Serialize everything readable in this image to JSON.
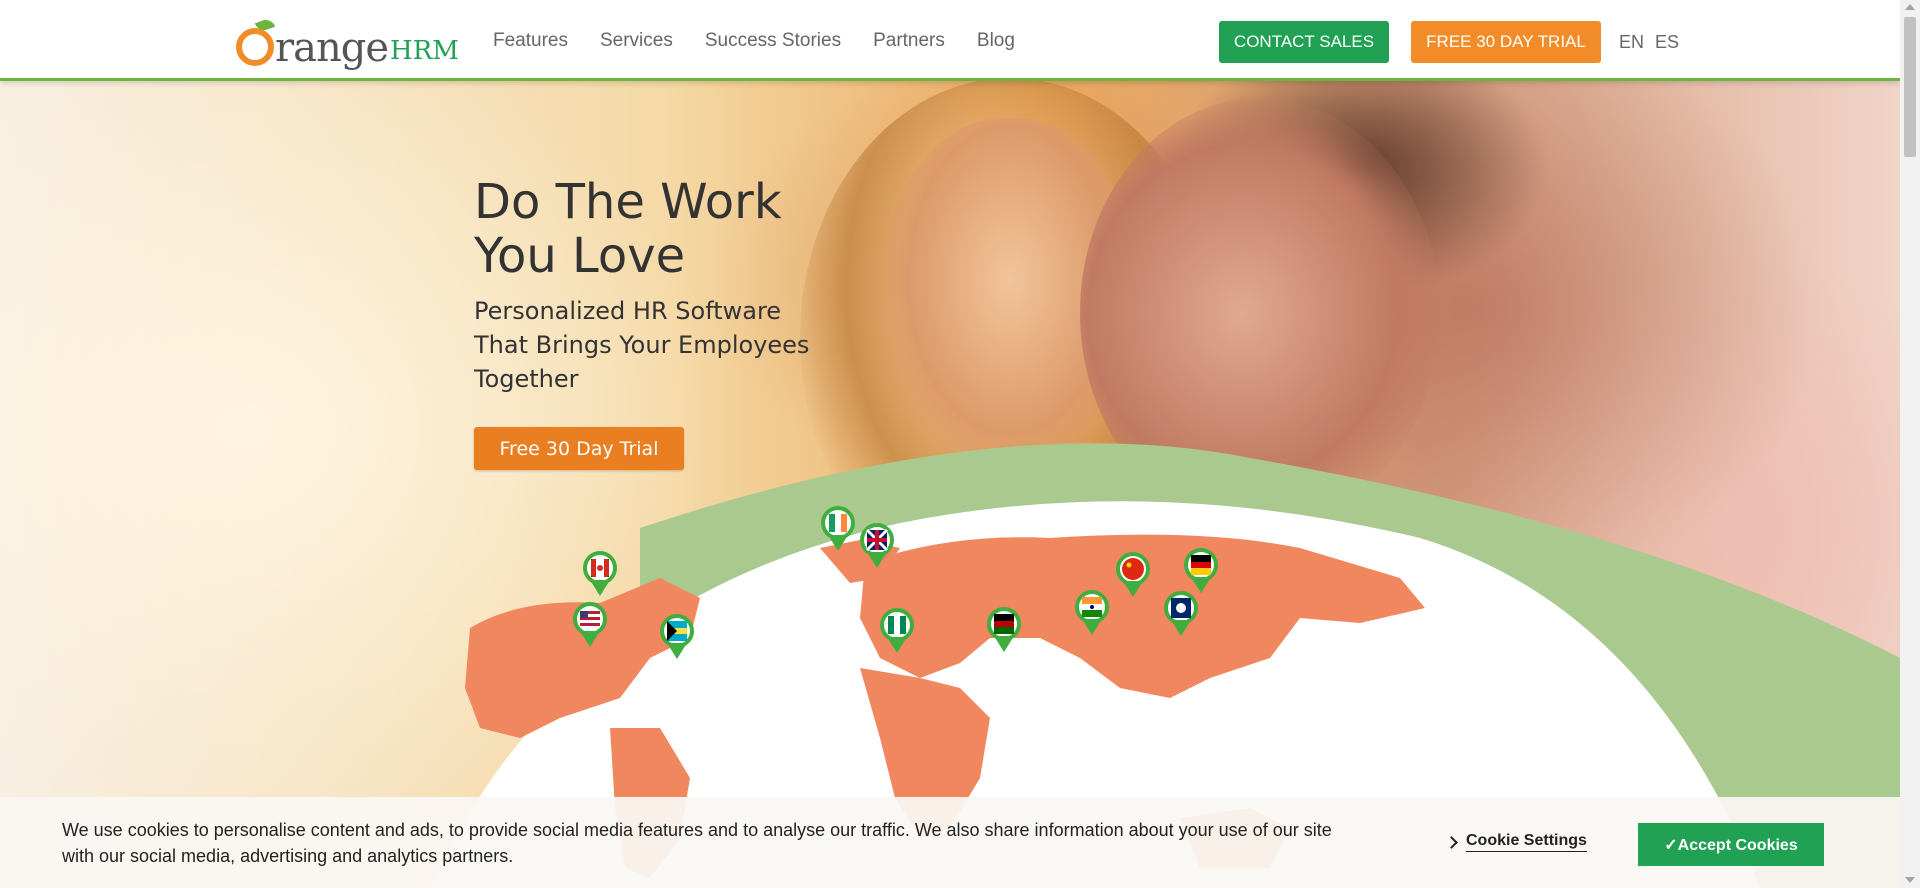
{
  "header": {
    "logo": {
      "text_main": "range",
      "text_brand": "HRM"
    },
    "nav": [
      {
        "label": "Features"
      },
      {
        "label": "Services"
      },
      {
        "label": "Success Stories"
      },
      {
        "label": "Partners"
      },
      {
        "label": "Blog"
      }
    ],
    "contact_sales_label": "CONTACT SALES",
    "free_trial_label": "FREE 30 DAY TRIAL",
    "languages": [
      "EN",
      "ES"
    ]
  },
  "hero": {
    "headline": "Do The Work You Love",
    "subheadline": "Personalized HR Software That Brings Your Employees Together",
    "cta_label": "Free 30 Day Trial",
    "map_pins": [
      {
        "flag": "canada-flag"
      },
      {
        "flag": "ireland-flag"
      },
      {
        "flag": "uk-flag"
      },
      {
        "flag": "usa-flag"
      },
      {
        "flag": "bahamas-flag"
      },
      {
        "flag": "nigeria-flag"
      },
      {
        "flag": "kenya-flag"
      },
      {
        "flag": "china-flag"
      },
      {
        "flag": "germany-flag"
      },
      {
        "flag": "india-flag"
      },
      {
        "flag": "laos-flag"
      }
    ]
  },
  "cookie_banner": {
    "message": "We use cookies to personalise content and ads, to provide social media features and to analyse our traffic. We also share information about your use of our site with our social media, advertising and analytics partners.",
    "settings_label": "Cookie Settings",
    "accept_label": "✓Accept Cookies"
  },
  "colors": {
    "brand_orange": "#f28c28",
    "brand_green": "#20a153",
    "map_orange": "#f0875f",
    "arc_green": "#a9c98f"
  }
}
